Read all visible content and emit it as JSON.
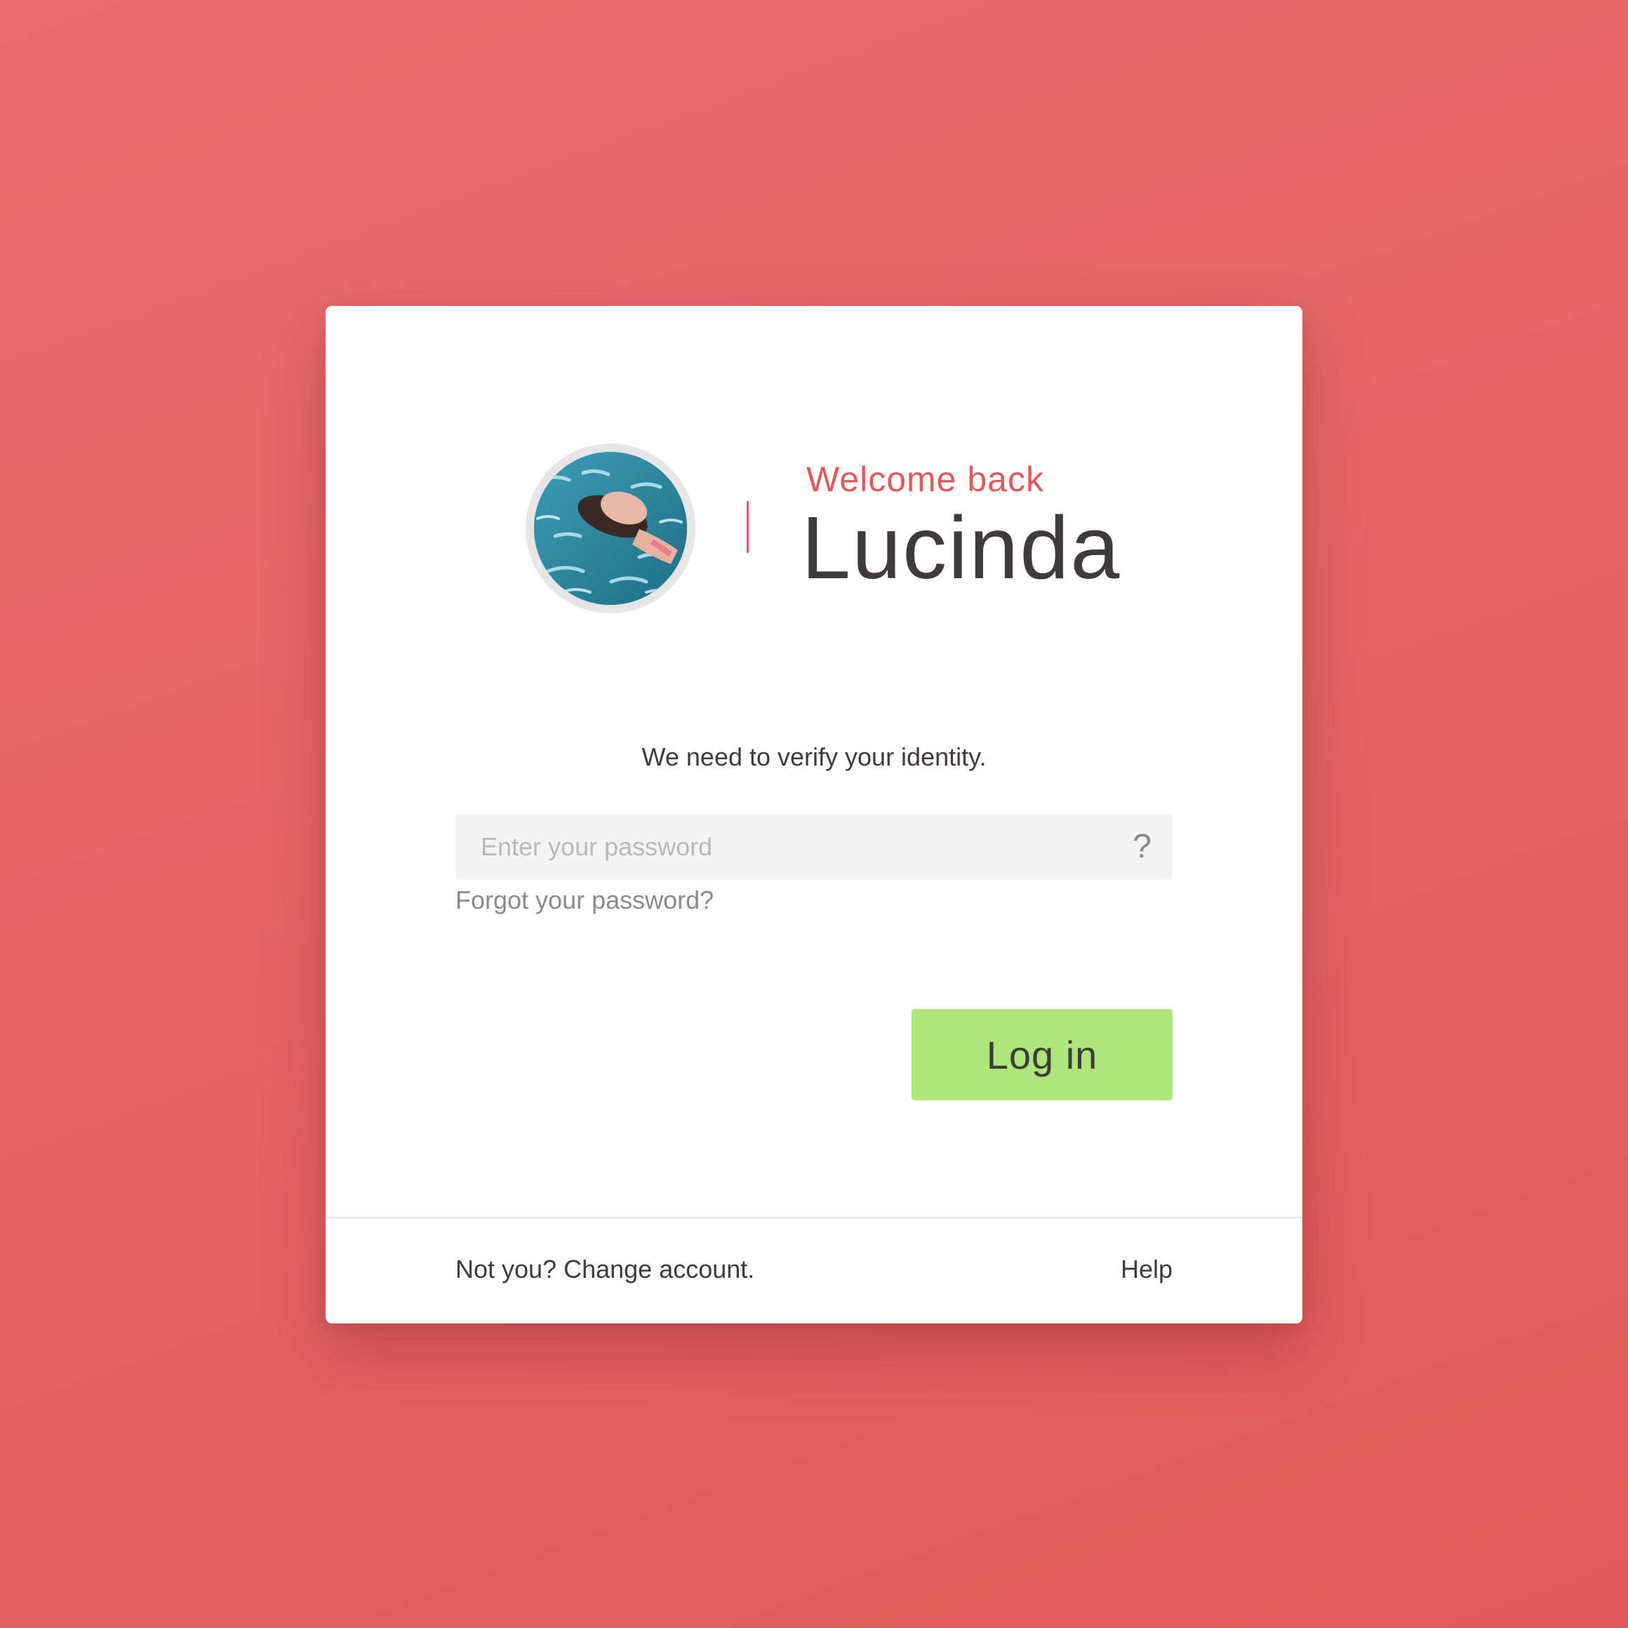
{
  "header": {
    "welcome": "Welcome back",
    "username": "Lucinda"
  },
  "avatar": {
    "description_icon": "user-avatar-photo"
  },
  "form": {
    "prompt": "We need to verify your identity.",
    "password_placeholder": "Enter your password",
    "password_value": "",
    "help_glyph": "?",
    "forgot_label": "Forgot your password?",
    "login_label": "Log in"
  },
  "footer": {
    "change_account": "Not you? Change account.",
    "help": "Help"
  },
  "colors": {
    "background": "#e4696a",
    "accent": "#e05a5c",
    "login_button": "#ade77c",
    "text_dark": "#3f3b3c"
  }
}
